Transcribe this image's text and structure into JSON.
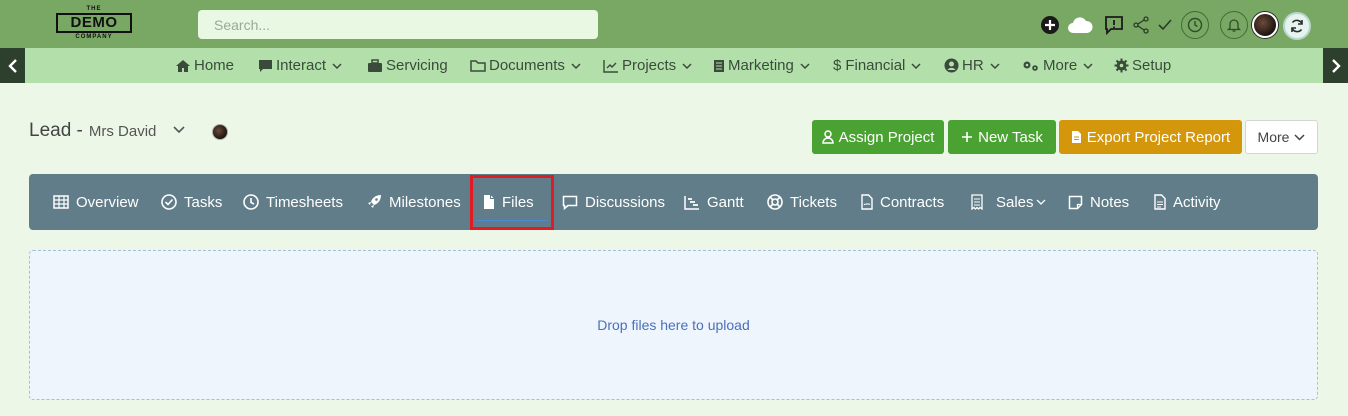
{
  "brand": {
    "top": "THE",
    "main": "DEMO",
    "bottom": "COMPANY"
  },
  "search": {
    "placeholder": "Search..."
  },
  "header_icons": [
    "plus-circle-icon",
    "cloud-icon",
    "feedback-icon",
    "share-icon",
    "check-icon",
    "clock-icon",
    "bell-icon",
    "avatar",
    "sync-icon"
  ],
  "nav": {
    "items": [
      {
        "label": "Home",
        "icon": "home-icon",
        "dropdown": false
      },
      {
        "label": "Interact",
        "icon": "chat-icon",
        "dropdown": true
      },
      {
        "label": "Servicing",
        "icon": "briefcase-icon",
        "dropdown": false
      },
      {
        "label": "Documents",
        "icon": "folder-icon",
        "dropdown": true
      },
      {
        "label": "Projects",
        "icon": "chart-icon",
        "dropdown": true
      },
      {
        "label": "Marketing",
        "icon": "document-icon",
        "dropdown": true
      },
      {
        "label": "Financial",
        "icon": "dollar-icon",
        "dropdown": true
      },
      {
        "label": "HR",
        "icon": "user-circle-icon",
        "dropdown": true
      },
      {
        "label": "More",
        "icon": "gears-icon",
        "dropdown": true
      },
      {
        "label": "Setup",
        "icon": "gear-icon",
        "dropdown": false
      }
    ]
  },
  "page": {
    "title": "Lead -",
    "subtitle": "Mrs David"
  },
  "actions": {
    "assign": "Assign Project",
    "new_task": "New Task",
    "export": "Export Project Report",
    "more": "More"
  },
  "tabs": [
    {
      "label": "Overview",
      "icon": "grid-icon"
    },
    {
      "label": "Tasks",
      "icon": "check-circle-icon"
    },
    {
      "label": "Timesheets",
      "icon": "clock-icon"
    },
    {
      "label": "Milestones",
      "icon": "rocket-icon"
    },
    {
      "label": "Files",
      "icon": "file-icon",
      "active": true
    },
    {
      "label": "Discussions",
      "icon": "comment-icon"
    },
    {
      "label": "Gantt",
      "icon": "gantt-icon"
    },
    {
      "label": "Tickets",
      "icon": "life-ring-icon"
    },
    {
      "label": "Contracts",
      "icon": "contract-icon"
    },
    {
      "label": "Sales",
      "icon": "receipt-icon",
      "dropdown": true
    },
    {
      "label": "Notes",
      "icon": "note-icon"
    },
    {
      "label": "Activity",
      "icon": "activity-icon"
    }
  ],
  "dropzone": {
    "text": "Drop files here to upload"
  },
  "colors": {
    "topbar": "#79a865",
    "navbar": "#b3e0aa",
    "tabbar": "#617d89",
    "green_button": "#4aa233",
    "orange_button": "#d4960a",
    "highlight": "#e01b24"
  }
}
